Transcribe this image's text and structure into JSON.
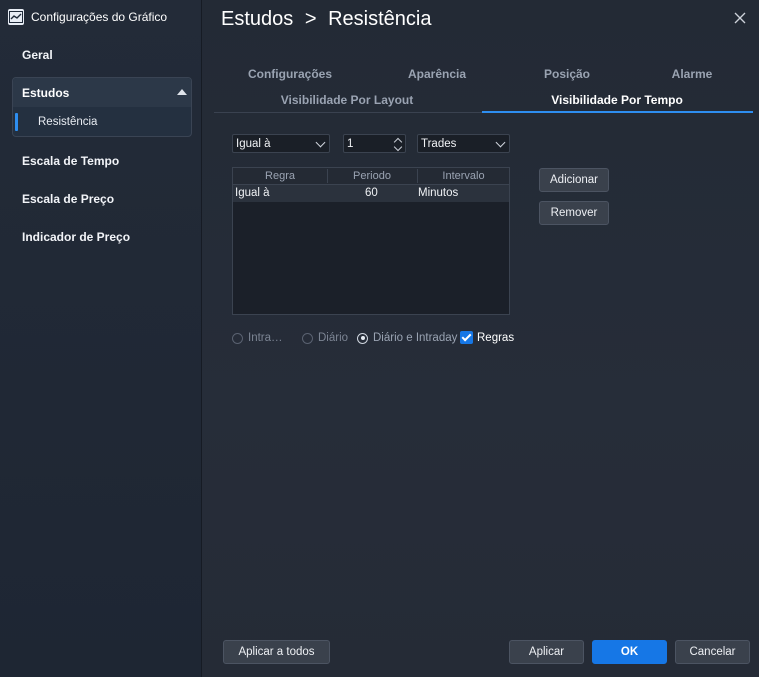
{
  "window": {
    "title": "Configurações do Gráfico"
  },
  "sidebar": {
    "items": [
      {
        "label": "Geral"
      },
      {
        "label": "Estudos"
      },
      {
        "label": "Escala de Tempo"
      },
      {
        "label": "Escala de Preço"
      },
      {
        "label": "Indicador de Preço"
      }
    ],
    "sub_items": [
      {
        "label": "Resistência"
      }
    ]
  },
  "header": {
    "section": "Estudos",
    "separator": ">",
    "page": "Resistência"
  },
  "tabs": {
    "row1": [
      {
        "label": "Configurações"
      },
      {
        "label": "Aparência"
      },
      {
        "label": "Posição"
      },
      {
        "label": "Alarme"
      }
    ],
    "row2": [
      {
        "label": "Visibilidade Por Layout"
      },
      {
        "label": "Visibilidade Por Tempo"
      }
    ],
    "active": "Visibilidade Por Tempo"
  },
  "filters": {
    "rule_value": "Igual à",
    "period_value": "1",
    "interval_value": "Trades"
  },
  "table": {
    "columns": [
      "Regra",
      "Periodo",
      "Intervalo"
    ],
    "rows": [
      {
        "rule": "Igual à",
        "period": "60",
        "interval": "Minutos"
      }
    ]
  },
  "side_buttons": {
    "add": "Adicionar",
    "remove": "Remover"
  },
  "options": {
    "intra": {
      "label": "Intra…",
      "checked": false
    },
    "diario": {
      "label": "Diário",
      "checked": false
    },
    "diario_intraday": {
      "label": "Diário e Intraday",
      "checked": true
    },
    "regras": {
      "label": "Regras",
      "checked": true
    }
  },
  "footer": {
    "apply_all": "Aplicar a todos",
    "apply": "Aplicar",
    "ok": "OK",
    "cancel": "Cancelar"
  },
  "colors": {
    "accent": "#1677e6",
    "panel": "#262d39",
    "sidebar": "#232b38"
  },
  "icons": {
    "app": "chart-line-icon",
    "close": "close-icon",
    "collapse": "chevron-up-icon"
  }
}
